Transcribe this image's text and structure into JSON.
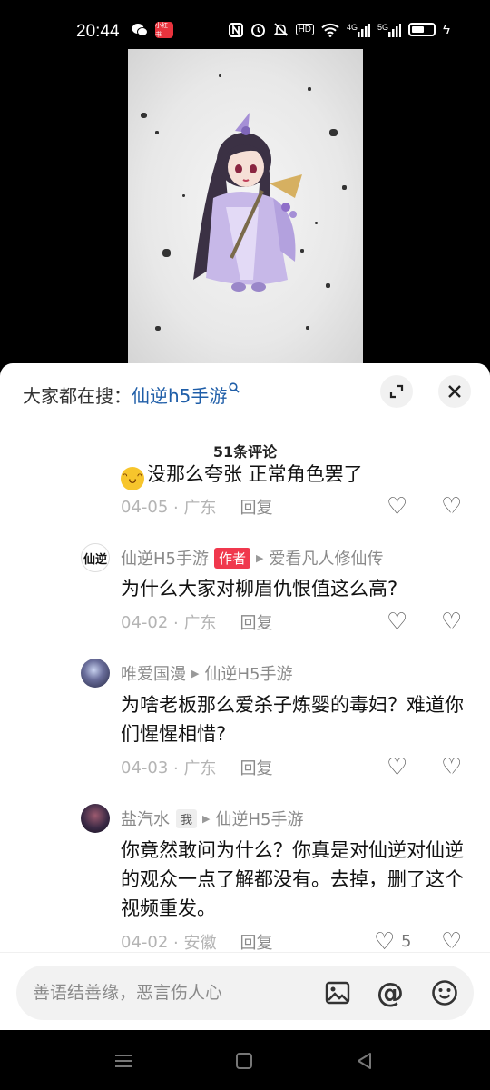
{
  "status_bar": {
    "time": "20:44",
    "app_badge": "小红书",
    "icons": [
      "nfc-icon",
      "alarm-icon",
      "mute-icon",
      "hd-icon",
      "wifi-icon",
      "signal-4g-icon",
      "signal-5g-icon",
      "battery-icon",
      "charging-icon"
    ],
    "hd_label": "HD",
    "net_4g": "4G",
    "net_5g": "5G"
  },
  "sheet": {
    "search_label": "大家都在搜：",
    "search_term": "仙逆h5手游",
    "comment_count": "51条评论"
  },
  "comments": [
    {
      "text": "没那么夸张 正常角色罢了",
      "date": "04-05",
      "region": "· 广东",
      "reply": "回复"
    },
    {
      "author": "仙逆H5手游",
      "author_badge": "作者",
      "reply_to": "爱看凡人修仙传",
      "text": "为什么大家对柳眉仇恨值这么高?",
      "date": "04-02",
      "region": "· 广东",
      "reply": "回复"
    },
    {
      "author": "唯爱国漫",
      "reply_to": "仙逆H5手游",
      "text": "为啥老板那么爱杀子炼婴的毒妇？难道你们惺惺相惜?",
      "date": "04-03",
      "region": "· 广东",
      "reply": "回复"
    },
    {
      "author": "盐汽水",
      "me_badge": "我",
      "reply_to": "仙逆H5手游",
      "text": "你竟然敢问为什么？你真是对仙逆对仙逆的观众一点了解都没有。去掉，删了这个视频重发。",
      "date": "04-02",
      "region": "· 安徽",
      "reply": "回复",
      "likes": "5"
    }
  ],
  "avatar_text": "仙逆",
  "input": {
    "placeholder": "善语结善缘，恶言伤人心"
  },
  "colors": {
    "accent_link": "#1f5ea8",
    "author_badge": "#f0384d"
  }
}
